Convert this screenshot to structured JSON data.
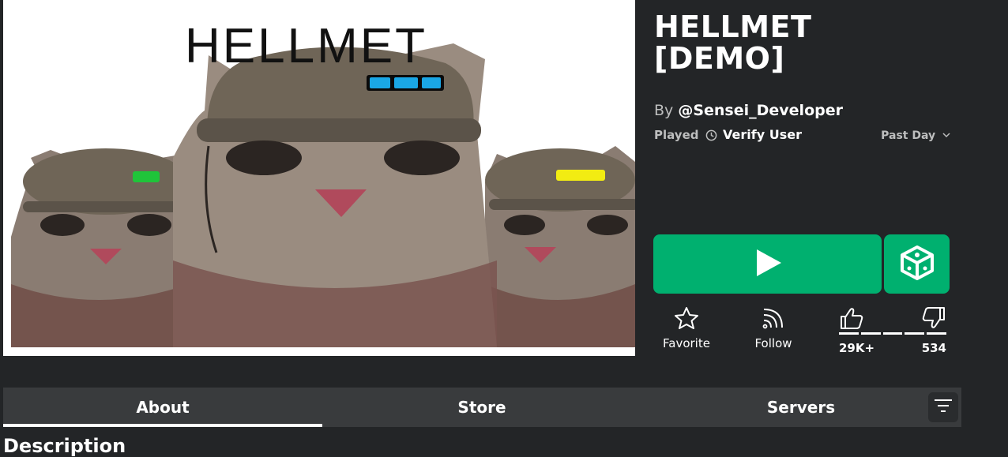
{
  "thumbnail": {
    "overlay_text": "HELLMET",
    "helmet_light_colors": [
      "#1aa7e6",
      "#1fc43a",
      "#f2ec12"
    ]
  },
  "game": {
    "title_line1": "HELLMET",
    "title_line2": "[DEMO]",
    "by_label": "By",
    "creator": "@Sensei_Developer",
    "played_label": "Played",
    "played_value": "Verify User",
    "period": "Past Day"
  },
  "actions": {
    "play_icon": "play-icon",
    "studio_icon": "studio-cube-icon",
    "favorite_label": "Favorite",
    "follow_label": "Follow",
    "upvotes": "29K+",
    "downvotes": "534"
  },
  "tabs": [
    {
      "label": "About",
      "active": true
    },
    {
      "label": "Store",
      "active": false
    },
    {
      "label": "Servers",
      "active": false
    }
  ],
  "filter_icon": "filter-icon",
  "description_heading": "Description",
  "colors": {
    "background": "#232527",
    "accent_green": "#00b06f",
    "tab_bar": "#393b3d"
  }
}
